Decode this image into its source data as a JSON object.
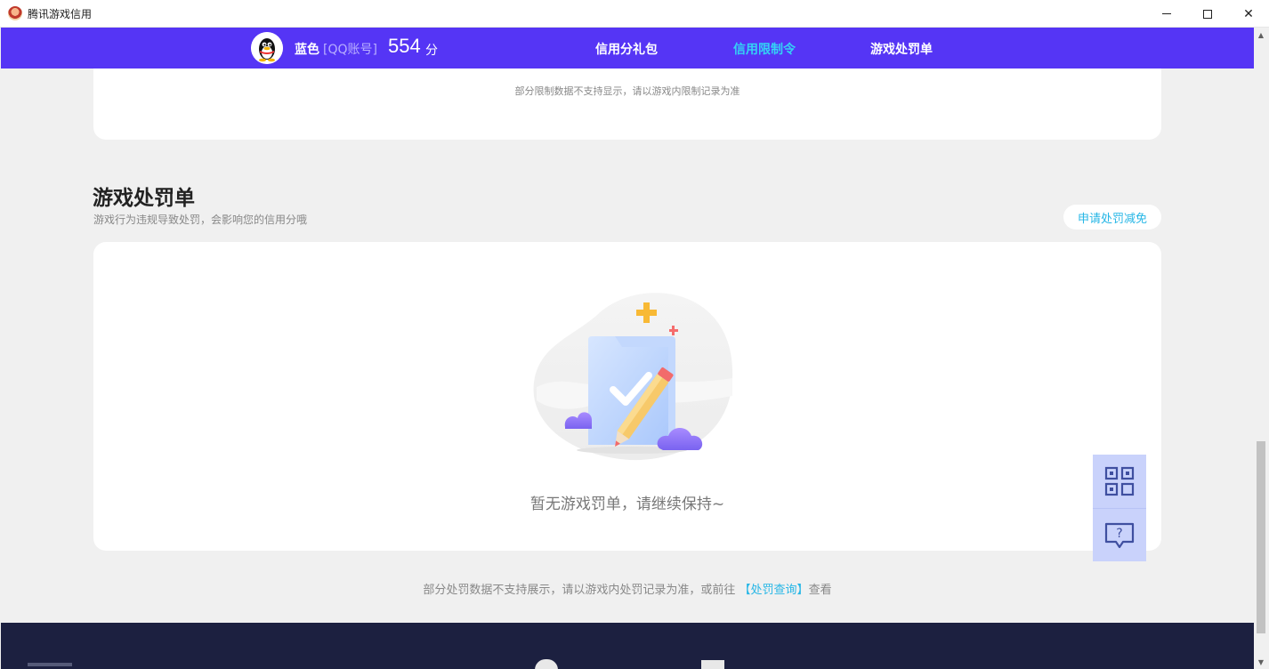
{
  "window": {
    "title": "腾讯游戏信用",
    "controls": {
      "minimize": "",
      "maximize": "",
      "close": "✕"
    }
  },
  "nav": {
    "nickname": "蓝色",
    "account_type": "[QQ账号]",
    "score": "554",
    "score_unit": "分",
    "tabs": [
      {
        "label": "信用分礼包",
        "active": false
      },
      {
        "label": "信用限制令",
        "active": true
      },
      {
        "label": "游戏处罚单",
        "active": false
      }
    ]
  },
  "restriction_card": {
    "note": "部分限制数据不支持显示，请以游戏内限制记录为准"
  },
  "penalty_section": {
    "title": "游戏处罚单",
    "subtitle": "游戏行为违规导致处罚，会影响您的信用分哦",
    "appeal_button": "申请处罚减免",
    "empty_text": "暂无游戏罚单，请继续保持~"
  },
  "footnote": {
    "before": "部分处罚数据不支持展示，请以游戏内处罚记录为准，或前往 ",
    "link": "【处罚查询】",
    "after": "查看"
  },
  "float_buttons": [
    {
      "icon": "qrcode-icon"
    },
    {
      "icon": "help-message-icon"
    }
  ],
  "colors": {
    "nav_bg": "#5535f5",
    "active_tab": "#33d3f5",
    "link": "#25b6e6",
    "footer_bg": "#1c2040",
    "float_bg": "#c9d2fb"
  }
}
